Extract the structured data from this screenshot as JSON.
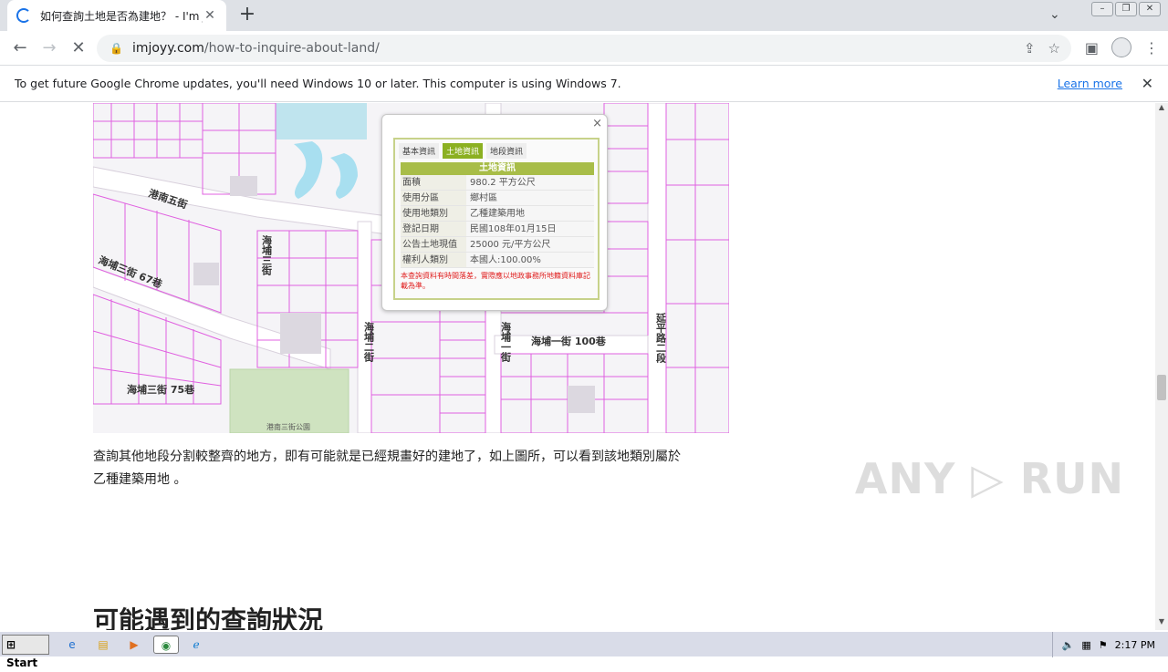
{
  "browser": {
    "tab_title": "如何查詢土地是否為建地？ - I'm Joy",
    "tab_close": "✕",
    "new_tab": "+",
    "url_host": "imjoyy.com",
    "url_path": "/how-to-inquire-about-land/"
  },
  "infobar": {
    "message": "To get future Google Chrome updates, you'll need Windows 10 or later. This computer is using Windows 7.",
    "learn_more": "Learn more"
  },
  "map": {
    "street_labels": [
      "港南五街",
      "海埔三街 67巷",
      "海埔三街",
      "海埔三街 75巷",
      "海埔二街",
      "海埔一街",
      "海埔一街 100巷",
      "延平路二段",
      "港南三街公園"
    ],
    "popup": {
      "close": "×",
      "tabs": [
        "基本資訊",
        "土地資訊",
        "地段資訊"
      ],
      "active_tab": "土地資訊",
      "table_title": "土地資訊",
      "rows": [
        {
          "k": "面積",
          "v": "980.2 平方公尺"
        },
        {
          "k": "使用分區",
          "v": "鄉村區"
        },
        {
          "k": "使用地類別",
          "v": "乙種建築用地"
        },
        {
          "k": "登記日期",
          "v": "民國108年01月15日"
        },
        {
          "k": "公告土地現值",
          "v": "25000 元/平方公尺"
        },
        {
          "k": "權利人類別",
          "v": "本國人:100.00%"
        }
      ],
      "note": "本查詢資料有時間落差，實際應以地政事務所地籍資料庫記載為準。"
    }
  },
  "article": {
    "paragraph_line1": "查詢其他地段分割較整齊的地方，即有可能就是已經規畫好的建地了，如上圖所，可以看到該地類別屬於",
    "paragraph_line2": "乙種建築用地 。",
    "heading": "可能遇到的查詢狀況"
  },
  "watermark": "ANY ▷ RUN",
  "taskbar": {
    "start": "Start",
    "clock": "2:17 PM"
  }
}
